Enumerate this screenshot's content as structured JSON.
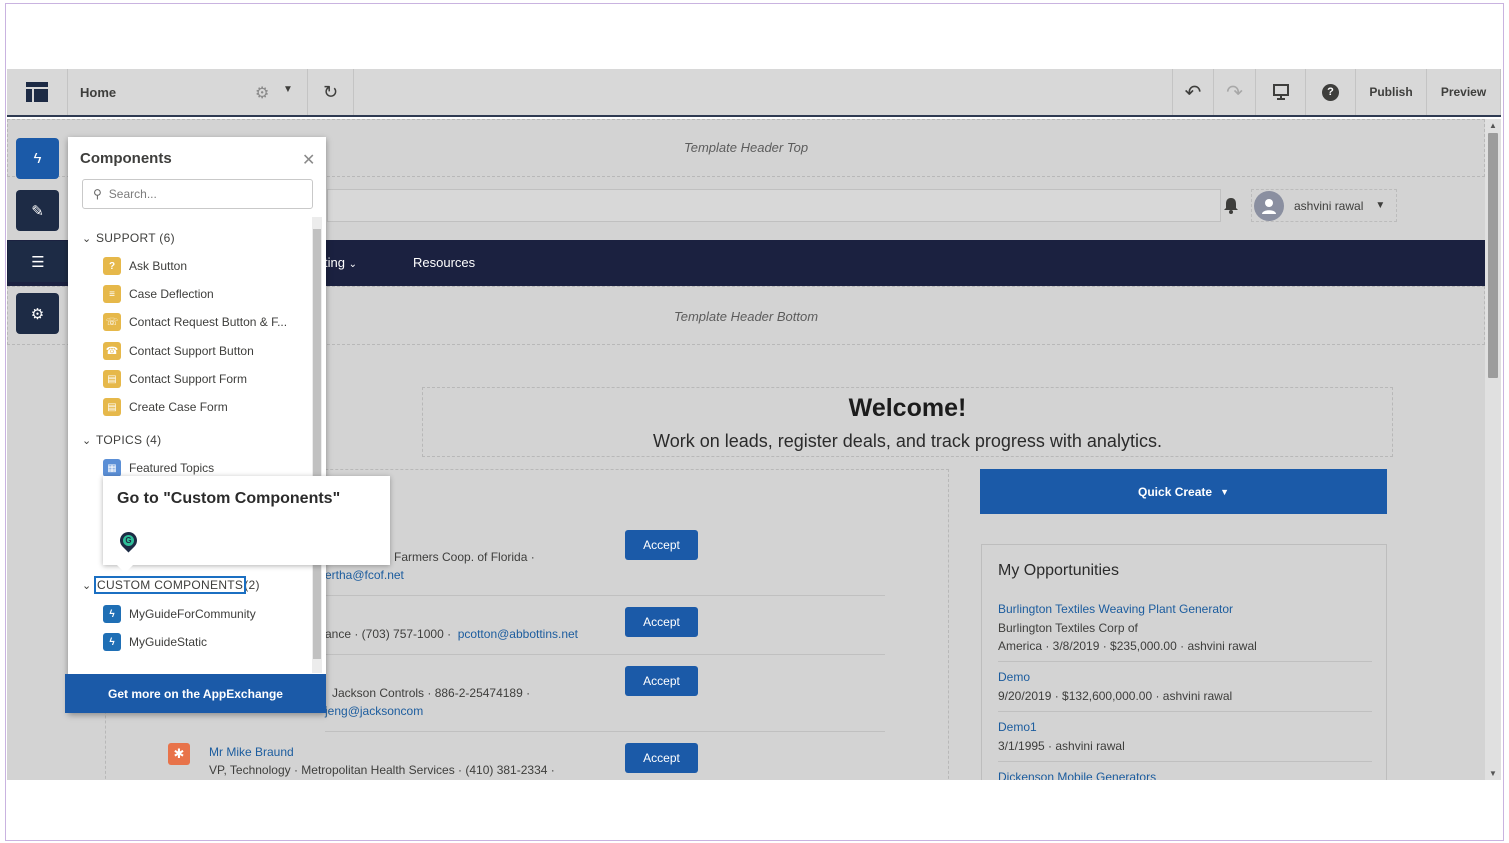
{
  "toolbar": {
    "page_name": "Home",
    "publish_label": "Publish",
    "preview_label": "Preview",
    "help_label": "?"
  },
  "canvas": {
    "header_top_label": "Template Header Top",
    "header_bottom_label": "Template Header Bottom",
    "user_name": "ashvini rawal",
    "nav_items": [
      "ting",
      "Resources"
    ],
    "welcome_title": "Welcome!",
    "welcome_subtitle": "Work on leads, register deals, and track progress with analytics.",
    "accept_label": "Accept",
    "leads": [
      {
        "line1": "Farmers Coop. of Florida  ·",
        "line2": "ertha@fcof.net"
      },
      {
        "line1_a": "ance  ·  (703) 757-1000  ·",
        "line1_link": "pcotton@abbottins.net"
      },
      {
        "line1": "Jackson Controls  ·  886-2-25474189  ·",
        "line2": "jeng@jacksoncom"
      },
      {
        "name": "Mr Mike Braund",
        "line1": "VP, Technology  ·  Metropolitan Health Services  ·  (410) 381-2334  ·"
      }
    ],
    "quick_create_label": "Quick Create",
    "opportunities": {
      "title": "My Opportunities",
      "items": [
        {
          "name": "Burlington Textiles Weaving Plant Generator",
          "detail1": "Burlington Textiles Corp of",
          "detail2": "America · 3/8/2019 · $235,000.00 · ashvini rawal"
        },
        {
          "name": "Demo",
          "detail1": "9/20/2019 · $132,600,000.00 · ashvini rawal"
        },
        {
          "name": "Demo1",
          "detail1": "3/1/1995 · ashvini rawal"
        },
        {
          "name": "Dickenson Mobile Generators"
        }
      ]
    }
  },
  "components_panel": {
    "title": "Components",
    "search_placeholder": "Search...",
    "sections": {
      "support": {
        "label": "SUPPORT (6)",
        "items": [
          "Ask Button",
          "Case Deflection",
          "Contact Request Button & F...",
          "Contact Support Button",
          "Contact Support Form",
          "Create Case Form"
        ]
      },
      "topics": {
        "label": "TOPICS (4)",
        "items": [
          "Featured Topics"
        ]
      },
      "custom": {
        "label": "CUSTOM COMPONENTS",
        "count": "(2)",
        "items": [
          "MyGuideForCommunity",
          "MyGuideStatic"
        ]
      }
    },
    "appexchange_label": "Get more on the AppExchange"
  },
  "guide_tooltip": {
    "text": "Go to \"Custom Components\""
  },
  "colors": {
    "accent_blue": "#1b5aa8",
    "nav_dark": "#1b2140",
    "support_icon": "#e6b84a",
    "topics_icon": "#5b8fd6",
    "custom_icon": "#1f6fb5",
    "highlight_outline": "#1b6fc2"
  }
}
